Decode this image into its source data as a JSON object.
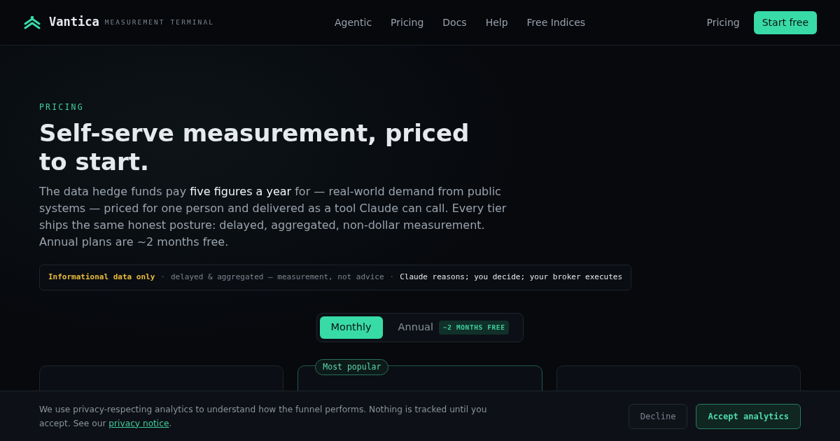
{
  "header": {
    "brand": "Vantica",
    "tagline": "MEASUREMENT TERMINAL",
    "nav": [
      "Agentic",
      "Pricing",
      "Docs",
      "Help",
      "Free Indices"
    ],
    "secondary_link": "Pricing",
    "cta": "Start free"
  },
  "hero": {
    "eyebrow": "PRICING",
    "title": "Self-serve measurement, priced to start.",
    "lead": "The data hedge funds pay **five figures a year** for — real-world demand from public systems — priced for one person and delivered as a tool Claude can call. Every tier ships the same honest posture: delayed, aggregated, non-dollar measurement. Annual plans are ~2 months free."
  },
  "disclaimer": [
    {
      "kind": "warning",
      "text": "Informational data only"
    },
    {
      "kind": "separator",
      "text": "·"
    },
    {
      "kind": "muted",
      "text": "delayed & aggregated — measurement, not advice"
    },
    {
      "kind": "separator",
      "text": "·"
    },
    {
      "kind": "emphasis",
      "text": "Claude reasons; you decide; your broker executes"
    }
  ],
  "billing_toggle": [
    {
      "label": "Monthly",
      "selected": true
    },
    {
      "label": "Annual",
      "selected": false,
      "badge": "~2 MONTHS FREE"
    }
  ],
  "plans": [
    {
      "featured": false
    },
    {
      "featured": true,
      "badge": "Most popular"
    },
    {
      "featured": false
    }
  ],
  "cookie_banner": {
    "text_before": "We use privacy-respecting analytics to understand how the funnel performs. Nothing is tracked until you accept. See our ",
    "link": "privacy notice",
    "text_after": ".",
    "buttons": [
      {
        "kind": "secondary",
        "label": "Decline"
      },
      {
        "kind": "primary",
        "label": "Accept analytics"
      }
    ]
  }
}
